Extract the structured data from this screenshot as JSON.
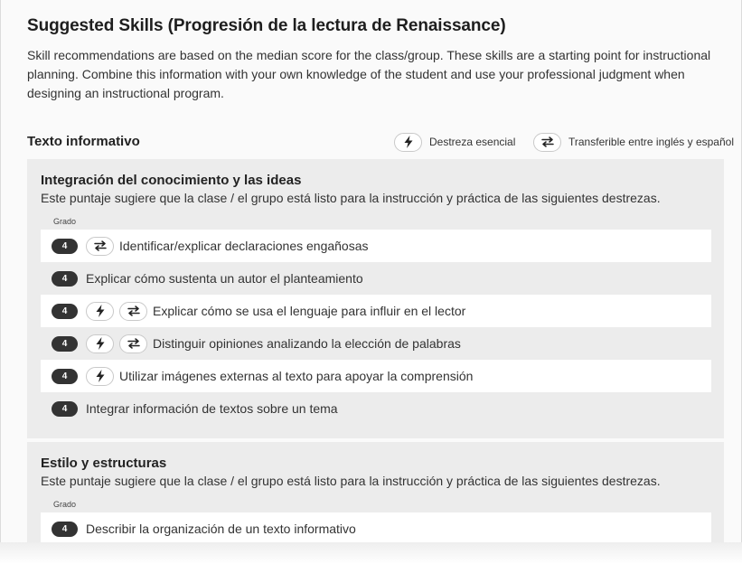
{
  "header": {
    "title": "Suggested Skills (Progresión de la lectura de Renaissance)",
    "description": "Skill recommendations are based on the median score for the class/group. These skills are a starting point for instructional planning. Combine this information with your own knowledge of the student and use your professional judgment when designing an instructional program."
  },
  "section": {
    "heading": "Texto informativo",
    "legend": [
      {
        "icon": "lightning-icon",
        "label": "Destreza esencial"
      },
      {
        "icon": "swap-arrows-icon",
        "label": "Transferible entre inglés y español"
      }
    ]
  },
  "cards": [
    {
      "title": "Integración del conocimiento y las ideas",
      "subtitle": "Este puntaje sugiere que la clase / el grupo está listo para la instrucción y práctica de las siguientes destrezas.",
      "grade_label": "Grado",
      "skills": [
        {
          "grade": "4",
          "icons": [
            "swap-arrows-icon"
          ],
          "text": "Identificar/explicar declaraciones engañosas"
        },
        {
          "grade": "4",
          "icons": [],
          "text": "Explicar cómo sustenta un autor el planteamiento"
        },
        {
          "grade": "4",
          "icons": [
            "lightning-icon",
            "swap-arrows-icon"
          ],
          "text": "Explicar cómo se usa el lenguaje para influir en el lector"
        },
        {
          "grade": "4",
          "icons": [
            "lightning-icon",
            "swap-arrows-icon"
          ],
          "text": "Distinguir opiniones analizando la elección de palabras"
        },
        {
          "grade": "4",
          "icons": [
            "lightning-icon"
          ],
          "text": "Utilizar imágenes externas al texto para apoyar la comprensión"
        },
        {
          "grade": "4",
          "icons": [],
          "text": "Integrar información de textos sobre un tema"
        }
      ]
    },
    {
      "title": "Estilo y estructuras",
      "subtitle": "Este puntaje sugiere que la clase / el grupo está listo para la instrucción y práctica de las siguientes destrezas.",
      "grade_label": "Grado",
      "skills": [
        {
          "grade": "4",
          "icons": [],
          "text": "Describir la organización de un texto informativo"
        }
      ]
    }
  ]
}
